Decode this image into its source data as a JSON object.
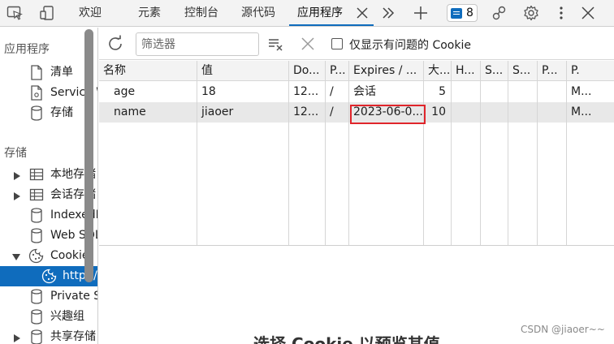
{
  "tabs": [
    {
      "label": "欢迎"
    },
    {
      "label": "元素"
    },
    {
      "label": "控制台"
    },
    {
      "label": "源代码"
    },
    {
      "label": "应用程序"
    }
  ],
  "issues_count": "8",
  "sidebar": {
    "app_section": "应用程序",
    "app_items": [
      "清单",
      "Service Workers",
      "存储"
    ],
    "storage_section": "存储",
    "storage_items": [
      "本地存储",
      "会话存储",
      "IndexedDB",
      "Web SQL",
      "Cookie",
      "http://localhost",
      "Private State Tokens",
      "兴趣组",
      "共享存储"
    ]
  },
  "toolbar": {
    "filter_placeholder": "筛选器",
    "only_issues_label": "仅显示有问题的 Cookie"
  },
  "table": {
    "columns": [
      "名称",
      "值",
      "Do...",
      "P...",
      "Expires / ...",
      "大...",
      "H...",
      "S...",
      "S...",
      "P...",
      "P."
    ],
    "rows": [
      [
        "age",
        "18",
        "12...",
        "/",
        "会话",
        "5",
        "",
        "",
        "",
        "",
        "M..."
      ],
      [
        "name",
        "jiaoer",
        "12...",
        "/",
        "2023-06-0...",
        "10",
        "",
        "",
        "",
        "",
        "M..."
      ]
    ]
  },
  "preview_hint": "选择 Cookie 以预览其值",
  "watermark": "CSDN @jiaoer~~",
  "colors": {
    "accent": "#0f6cbd",
    "highlight": "#e0252b"
  }
}
